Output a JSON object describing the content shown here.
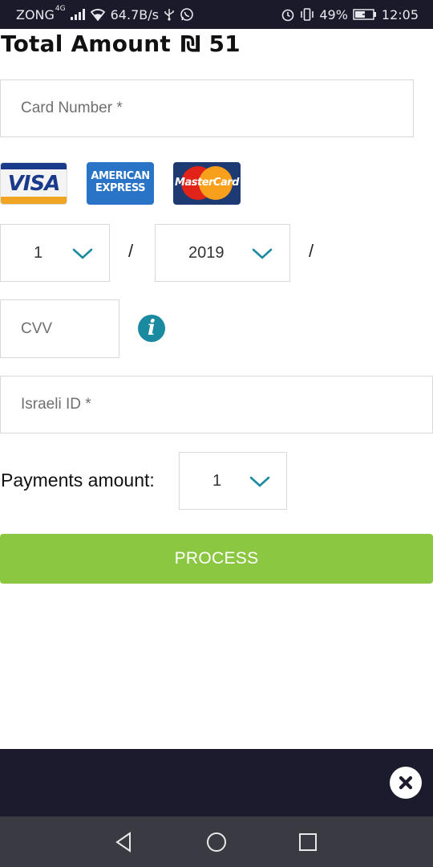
{
  "status_bar": {
    "carrier": "ZONG",
    "network_type": "4G",
    "speed": "64.7B/s",
    "battery": "49%",
    "time": "12:05",
    "icons": [
      "signal-icon",
      "wifi-icon",
      "usb-icon",
      "whatsapp-icon",
      "alarm-icon",
      "vibrate-icon",
      "battery-charging-icon"
    ]
  },
  "header": {
    "total_label": "Total Amount",
    "currency": "₪",
    "amount": "51"
  },
  "form": {
    "card_number_placeholder": "Card Number *",
    "card_logos": [
      "VISA",
      "AMERICAN EXPRESS",
      "MasterCard"
    ],
    "amex_line1": "AMERICAN",
    "amex_line2": "EXPRESS",
    "visa_text": "VISA",
    "mc_text": "MasterCard",
    "month": "1",
    "year": "2019",
    "separator": "/",
    "cvv_placeholder": "CVV",
    "info_glyph": "i",
    "israeli_id_placeholder": "Israeli ID *",
    "payments_label": "Payments amount:",
    "payments_value": "1",
    "process_label": "PROCESS"
  },
  "colors": {
    "accent_teal": "#1a8aa0",
    "process_green": "#8bc740",
    "status_bar_bg": "#1a1a2a",
    "bottom_bar_bg": "#1b1b2d",
    "nav_bar_bg": "#3a3a43"
  },
  "nav": {
    "icons": [
      "back-icon",
      "home-icon",
      "recents-icon"
    ]
  }
}
